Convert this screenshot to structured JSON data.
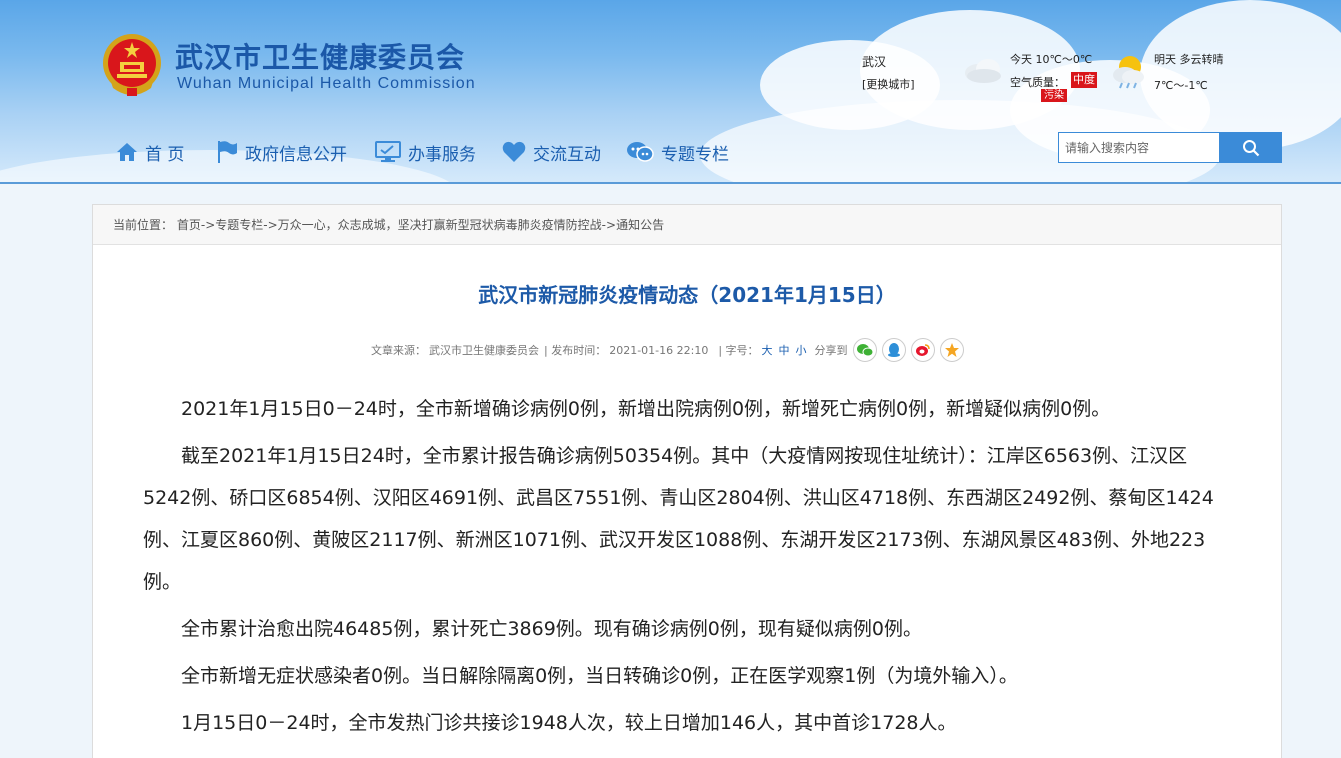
{
  "header": {
    "title_cn": "武汉市卫生健康委员会",
    "title_en": "Wuhan Municipal Health Commission",
    "city": "武汉",
    "change_city": "[更换城市]",
    "weather_today": "今天  10℃～0℃",
    "air_quality_label": "空气质量：",
    "air_quality_value": "中度",
    "air_quality_value2": "污染",
    "weather_tomorrow": "明天  多云转晴",
    "weather_tomorrow_temp": "7℃～-1℃"
  },
  "nav": {
    "items": [
      {
        "label": "首  页",
        "icon": "home-icon"
      },
      {
        "label": "政府信息公开",
        "icon": "flag-icon"
      },
      {
        "label": "办事服务",
        "icon": "monitor-icon"
      },
      {
        "label": "交流互动",
        "icon": "heart-icon"
      },
      {
        "label": "专题专栏",
        "icon": "chat-icon"
      }
    ]
  },
  "search": {
    "placeholder": "请输入搜索内容"
  },
  "breadcrumb": {
    "label": "当前位置：",
    "items": [
      "首页",
      "专题专栏",
      "万众一心，众志成城，坚决打赢新型冠状病毒肺炎疫情防控战",
      "通知公告"
    ],
    "sep": "->"
  },
  "article": {
    "title": "武汉市新冠肺炎疫情动态（2021年1月15日）",
    "source_label": "文章来源：",
    "source": "武汉市卫生健康委员会",
    "publish_label": "| 发布时间：",
    "publish_time": "2021-01-16 22:10",
    "fontsize_label": "| 字号：",
    "fontsize_large": "大",
    "fontsize_medium": "中",
    "fontsize_small": "小",
    "share_label": "分享到",
    "paragraphs": [
      "2021年1月15日0－24时，全市新增确诊病例0例，新增出院病例0例，新增死亡病例0例，新增疑似病例0例。",
      "截至2021年1月15日24时，全市累计报告确诊病例50354例。其中（大疫情网按现住址统计）：江岸区6563例、江汉区5242例、硚口区6854例、汉阳区4691例、武昌区7551例、青山区2804例、洪山区4718例、东西湖区2492例、蔡甸区1424例、江夏区860例、黄陂区2117例、新洲区1071例、武汉开发区1088例、东湖开发区2173例、东湖风景区483例、外地223例。",
      "全市累计治愈出院46485例，累计死亡3869例。现有确诊病例0例，现有疑似病例0例。",
      "全市新增无症状感染者0例。当日解除隔离0例，当日转确诊0例，正在医学观察1例（为境外输入）。",
      "1月15日0－24时，全市发热门诊共接诊1948人次，较上日增加146人，其中首诊1728人。"
    ]
  },
  "colors": {
    "brand": "#1b58a8",
    "accent": "#3b8bd8",
    "air_badge": "#d9161b"
  }
}
